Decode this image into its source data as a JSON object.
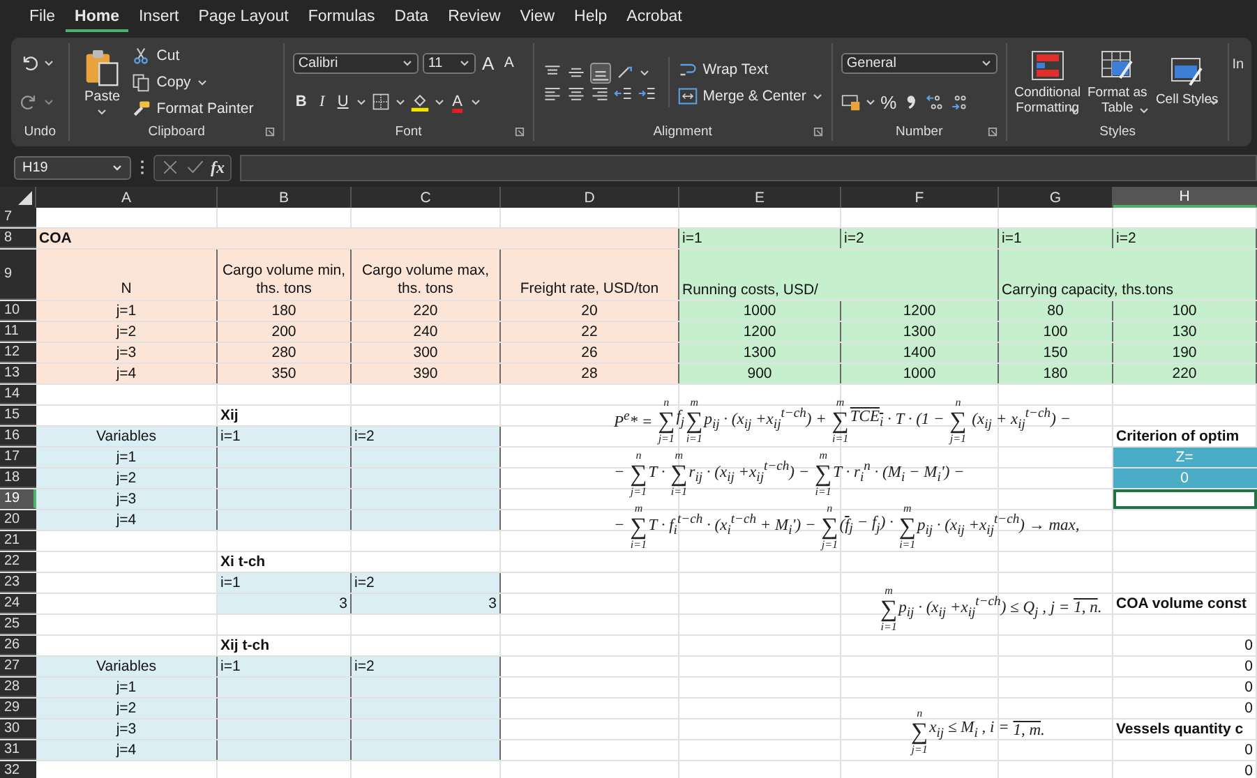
{
  "menu": [
    {
      "label": "File",
      "selected": false
    },
    {
      "label": "Home",
      "selected": true
    },
    {
      "label": "Insert",
      "selected": false
    },
    {
      "label": "Page Layout",
      "selected": false
    },
    {
      "label": "Formulas",
      "selected": false
    },
    {
      "label": "Data",
      "selected": false
    },
    {
      "label": "Review",
      "selected": false
    },
    {
      "label": "View",
      "selected": false
    },
    {
      "label": "Help",
      "selected": false
    },
    {
      "label": "Acrobat",
      "selected": false
    }
  ],
  "ribbon": {
    "undo": {
      "label": "Undo"
    },
    "clipboard": {
      "paste": "Paste",
      "cut": "Cut",
      "copy": "Copy",
      "format_painter": "Format Painter",
      "label": "Clipboard"
    },
    "font": {
      "family": "Calibri",
      "size": "11",
      "grow": "A",
      "shrink": "A",
      "bold": "B",
      "italic": "I",
      "underline": "U",
      "font_color_letter": "A",
      "label": "Font"
    },
    "alignment": {
      "wrap": "Wrap Text",
      "merge": "Merge & Center",
      "label": "Alignment"
    },
    "number": {
      "format": "General",
      "percent": "%",
      "label": "Number"
    },
    "styles": {
      "buttons": [
        "Conditional Formatting",
        "Format as Table",
        "Cell Styles"
      ],
      "label": "Styles"
    },
    "cut_off": "In"
  },
  "formula_bar": {
    "name_box": "H19",
    "fx": "fx"
  },
  "columns": [
    {
      "label": "A",
      "selected": false
    },
    {
      "label": "B",
      "selected": false
    },
    {
      "label": "C",
      "selected": false
    },
    {
      "label": "D",
      "selected": false
    },
    {
      "label": "E",
      "selected": false
    },
    {
      "label": "F",
      "selected": false
    },
    {
      "label": "G",
      "selected": false
    },
    {
      "label": "H",
      "selected": true
    }
  ],
  "rows": [
    {
      "number": "7",
      "selected": false,
      "cells": [
        null,
        null,
        null,
        null,
        null,
        null,
        null,
        null
      ]
    },
    {
      "number": "8",
      "selected": false,
      "cells": [
        {
          "text": "COA",
          "merged": true,
          "color": "#fce4d6",
          "kind": "title"
        },
        null,
        null,
        null,
        {
          "text": "i=1",
          "color": "#c6efce",
          "kind": "tag"
        },
        {
          "text": "i=2",
          "color": "#c6efce",
          "kind": "tag"
        },
        {
          "text": "i=1",
          "color": "#c6efce",
          "kind": "tag"
        },
        {
          "text": "i=2",
          "color": "#c6efce",
          "kind": "tag"
        }
      ]
    },
    {
      "number": "9",
      "selected": false,
      "cells": [
        {
          "text": "N",
          "color": "#fce4d6",
          "kind": "head"
        },
        {
          "text": "Cargo volume min, ths. tons",
          "color": "#fce4d6",
          "kind": "head"
        },
        {
          "text": "Cargo volume max, ths. tons",
          "color": "#fce4d6",
          "kind": "head"
        },
        {
          "text": "Freight rate, USD/ton",
          "color": "#fce4d6",
          "kind": "head"
        },
        {
          "text": "Running costs, USD/",
          "merged": true,
          "color": "#c6efce",
          "kind": "headleft"
        },
        null,
        {
          "text": "Carrying capacity, ths.tons",
          "merged": true,
          "color": "#c6efce",
          "kind": "headleft"
        },
        null
      ]
    },
    {
      "number": "10",
      "selected": false,
      "cells": [
        {
          "text": "j=1",
          "color": "#fce4d6",
          "kind": "value"
        },
        {
          "text": "180",
          "color": "#fce4d6",
          "kind": "value"
        },
        {
          "text": "220",
          "color": "#fce4d6",
          "kind": "value"
        },
        {
          "text": "20",
          "color": "#fce4d6",
          "kind": "value"
        },
        {
          "text": "1000",
          "color": "#c6efce",
          "kind": "value"
        },
        {
          "text": "1200",
          "color": "#c6efce",
          "kind": "value"
        },
        {
          "text": "80",
          "color": "#c6efce",
          "kind": "value"
        },
        {
          "text": "100",
          "color": "#c6efce",
          "kind": "value"
        }
      ]
    },
    {
      "number": "11",
      "selected": false,
      "cells": [
        {
          "text": "j=2",
          "color": "#fce4d6",
          "kind": "value"
        },
        {
          "text": "200",
          "color": "#fce4d6",
          "kind": "value"
        },
        {
          "text": "240",
          "color": "#fce4d6",
          "kind": "value"
        },
        {
          "text": "22",
          "color": "#fce4d6",
          "kind": "value"
        },
        {
          "text": "1200",
          "color": "#c6efce",
          "kind": "value"
        },
        {
          "text": "1300",
          "color": "#c6efce",
          "kind": "value"
        },
        {
          "text": "100",
          "color": "#c6efce",
          "kind": "value"
        },
        {
          "text": "130",
          "color": "#c6efce",
          "kind": "value"
        }
      ]
    },
    {
      "number": "12",
      "selected": false,
      "cells": [
        {
          "text": "j=3",
          "color": "#fce4d6",
          "kind": "value"
        },
        {
          "text": "280",
          "color": "#fce4d6",
          "kind": "value"
        },
        {
          "text": "300",
          "color": "#fce4d6",
          "kind": "value"
        },
        {
          "text": "26",
          "color": "#fce4d6",
          "kind": "value"
        },
        {
          "text": "1300",
          "color": "#c6efce",
          "kind": "value"
        },
        {
          "text": "1400",
          "color": "#c6efce",
          "kind": "value"
        },
        {
          "text": "150",
          "color": "#c6efce",
          "kind": "value"
        },
        {
          "text": "190",
          "color": "#c6efce",
          "kind": "value"
        }
      ]
    },
    {
      "number": "13",
      "selected": false,
      "cells": [
        {
          "text": "j=4",
          "color": "#fce4d6",
          "kind": "value"
        },
        {
          "text": "350",
          "color": "#fce4d6",
          "kind": "value"
        },
        {
          "text": "390",
          "color": "#fce4d6",
          "kind": "value"
        },
        {
          "text": "28",
          "color": "#fce4d6",
          "kind": "value"
        },
        {
          "text": "900",
          "color": "#c6efce",
          "kind": "value"
        },
        {
          "text": "1000",
          "color": "#c6efce",
          "kind": "value"
        },
        {
          "text": "180",
          "color": "#c6efce",
          "kind": "value"
        },
        {
          "text": "220",
          "color": "#c6efce",
          "kind": "value"
        }
      ]
    },
    {
      "number": "14",
      "selected": false,
      "cells": [
        null,
        null,
        null,
        null,
        null,
        null,
        null,
        null
      ]
    },
    {
      "number": "15",
      "selected": false,
      "cells": [
        null,
        {
          "text": "Xij",
          "kind": "title"
        },
        null,
        null,
        null,
        null,
        null,
        null
      ]
    },
    {
      "number": "16",
      "selected": false,
      "cells": [
        {
          "text": "Variables",
          "color": "#daeef3",
          "kind": "value"
        },
        {
          "text": "i=1",
          "color": "#daeef3",
          "kind": "tag"
        },
        {
          "text": "i=2",
          "color": "#daeef3",
          "kind": "tag"
        },
        null,
        null,
        null,
        null,
        {
          "text": "Criterion of optim",
          "kind": "title"
        }
      ]
    },
    {
      "number": "17",
      "selected": false,
      "cells": [
        {
          "text": "j=1",
          "color": "#daeef3",
          "kind": "value"
        },
        {
          "color": "#daeef3",
          "kind": "value"
        },
        {
          "color": "#daeef3",
          "kind": "value"
        },
        null,
        null,
        null,
        null,
        {
          "text": "Z=",
          "color": "#4bacc6",
          "kind": "result"
        }
      ]
    },
    {
      "number": "18",
      "selected": false,
      "cells": [
        {
          "text": "j=2",
          "color": "#daeef3",
          "kind": "value"
        },
        {
          "color": "#daeef3",
          "kind": "value"
        },
        {
          "color": "#daeef3",
          "kind": "value"
        },
        null,
        null,
        null,
        null,
        {
          "text": "0",
          "color": "#4bacc6",
          "kind": "result"
        }
      ]
    },
    {
      "number": "19",
      "selected": true,
      "cells": [
        {
          "text": "j=3",
          "color": "#daeef3",
          "kind": "value"
        },
        {
          "color": "#daeef3",
          "kind": "value"
        },
        {
          "color": "#daeef3",
          "kind": "value"
        },
        null,
        null,
        null,
        null,
        null
      ]
    },
    {
      "number": "20",
      "selected": false,
      "cells": [
        {
          "text": "j=4",
          "color": "#daeef3",
          "kind": "value"
        },
        {
          "color": "#daeef3",
          "kind": "value"
        },
        {
          "color": "#daeef3",
          "kind": "value"
        },
        null,
        null,
        null,
        null,
        null
      ]
    },
    {
      "number": "21",
      "selected": false,
      "cells": [
        null,
        null,
        null,
        null,
        null,
        null,
        null,
        null
      ]
    },
    {
      "number": "22",
      "selected": false,
      "cells": [
        null,
        {
          "text": "Xi t-ch",
          "kind": "title"
        },
        null,
        null,
        null,
        null,
        null,
        null
      ]
    },
    {
      "number": "23",
      "selected": false,
      "cells": [
        null,
        {
          "text": "i=1",
          "color": "#daeef3",
          "kind": "tag"
        },
        {
          "text": "i=2",
          "color": "#daeef3",
          "kind": "tag"
        },
        null,
        null,
        null,
        null,
        null
      ]
    },
    {
      "number": "24",
      "selected": false,
      "cells": [
        null,
        {
          "text": "3",
          "color": "#daeef3",
          "kind": "number"
        },
        {
          "text": "3",
          "color": "#daeef3",
          "kind": "number"
        },
        null,
        null,
        null,
        null,
        {
          "text": "COA volume const",
          "kind": "title"
        }
      ]
    },
    {
      "number": "25",
      "selected": false,
      "cells": [
        null,
        null,
        null,
        null,
        null,
        null,
        null,
        null
      ]
    },
    {
      "number": "26",
      "selected": false,
      "cells": [
        null,
        {
          "text": "Xij t-ch",
          "kind": "title"
        },
        null,
        null,
        null,
        null,
        null,
        {
          "text": "0",
          "kind": "number"
        }
      ]
    },
    {
      "number": "27",
      "selected": false,
      "cells": [
        {
          "text": "Variables",
          "color": "#daeef3",
          "kind": "value"
        },
        {
          "text": "i=1",
          "color": "#daeef3",
          "kind": "tag"
        },
        {
          "text": "i=2",
          "color": "#daeef3",
          "kind": "tag"
        },
        null,
        null,
        null,
        null,
        {
          "text": "0",
          "kind": "number"
        }
      ]
    },
    {
      "number": "28",
      "selected": false,
      "cells": [
        {
          "text": "j=1",
          "color": "#daeef3",
          "kind": "value"
        },
        {
          "color": "#daeef3",
          "kind": "value"
        },
        {
          "color": "#daeef3",
          "kind": "value"
        },
        null,
        null,
        null,
        null,
        {
          "text": "0",
          "kind": "number"
        }
      ]
    },
    {
      "number": "29",
      "selected": false,
      "cells": [
        {
          "text": "j=2",
          "color": "#daeef3",
          "kind": "value"
        },
        {
          "color": "#daeef3",
          "kind": "value"
        },
        {
          "color": "#daeef3",
          "kind": "value"
        },
        null,
        null,
        null,
        null,
        {
          "text": "0",
          "kind": "number"
        }
      ]
    },
    {
      "number": "30",
      "selected": false,
      "cells": [
        {
          "text": "j=3",
          "color": "#daeef3",
          "kind": "value"
        },
        {
          "color": "#daeef3",
          "kind": "value"
        },
        {
          "color": "#daeef3",
          "kind": "value"
        },
        null,
        null,
        null,
        null,
        {
          "text": "Vessels quantity c",
          "kind": "title"
        }
      ]
    },
    {
      "number": "31",
      "selected": false,
      "cells": [
        {
          "text": "j=4",
          "color": "#daeef3",
          "kind": "value"
        },
        {
          "color": "#daeef3",
          "kind": "value"
        },
        {
          "color": "#daeef3",
          "kind": "value"
        },
        null,
        null,
        null,
        null,
        {
          "text": "0",
          "kind": "number"
        }
      ]
    },
    {
      "number": "32",
      "selected": false,
      "cells": [
        null,
        null,
        null,
        null,
        null,
        null,
        null,
        {
          "text": "0",
          "kind": "number"
        }
      ]
    }
  ],
  "formulas": [
    {
      "lines": [
        [
          {
            "kind": "text",
            "text": "P$^{e}$* = "
          },
          {
            "kind": "sum",
            "symbol": "∑",
            "upper": "n",
            "lower": "j=1"
          },
          {
            "kind": "text",
            "text": "f$_{j}$"
          },
          {
            "kind": "sum",
            "symbol": "∑",
            "upper": "m",
            "lower": "i=1"
          },
          {
            "kind": "text",
            "text": "p$_{ij}$ · (x$_{ij}$ +x$_{ij}$$^{t−ch}$) + "
          },
          {
            "kind": "sum",
            "symbol": "∑",
            "upper": "m",
            "lower": "i=1"
          },
          {
            "kind": "over",
            "text": "TCE$_{i}$"
          },
          {
            "kind": "text",
            "text": " · T · (1 − "
          },
          {
            "kind": "sum",
            "symbol": "∑",
            "upper": "n",
            "lower": "j=1"
          },
          {
            "kind": "text",
            "text": " (x$_{ij}$ + x$_{ij}$$^{t−ch}$) −"
          }
        ],
        [
          {
            "kind": "text",
            "text": "− "
          },
          {
            "kind": "sum",
            "symbol": "∑",
            "upper": "n",
            "lower": "j=1"
          },
          {
            "kind": "text",
            "text": "T · "
          },
          {
            "kind": "sum",
            "symbol": "∑",
            "upper": "m",
            "lower": "i=1"
          },
          {
            "kind": "text",
            "text": "r$_{ij}$ · (x$_{ij}$ +x$_{ij}$$^{t−ch}$) − "
          },
          {
            "kind": "sum",
            "symbol": "∑",
            "upper": "m",
            "lower": "i=1"
          },
          {
            "kind": "text",
            "text": "T · r$_{i}$$^{n}$ · (M$_{i}$ − M$_{i}$ʹ) −"
          }
        ],
        [
          {
            "kind": "text",
            "text": "− "
          },
          {
            "kind": "sum",
            "symbol": "∑",
            "upper": "m",
            "lower": "i=1"
          },
          {
            "kind": "text",
            "text": "T · f$_{i}$$^{t−ch}$ · (x$_{i}$$^{t−ch}$ + M$_{i}$ʹ) − "
          },
          {
            "kind": "sum",
            "symbol": "∑",
            "upper": "n",
            "lower": "j=1"
          },
          {
            "kind": "text",
            "text": "("
          },
          {
            "kind": "over",
            "text": "f"
          },
          {
            "kind": "text",
            "text": "$_{j}$ − f$_{j}$) · "
          },
          {
            "kind": "sum",
            "symbol": "∑",
            "upper": "m",
            "lower": "i=1"
          },
          {
            "kind": "text",
            "text": "p$_{ij}$ · (x$_{ij}$ +x$_{ij}$$^{t−ch}$) → max,"
          }
        ]
      ]
    },
    {
      "lines": [
        [
          {
            "kind": "sum",
            "symbol": "∑",
            "upper": "m",
            "lower": "i=1"
          },
          {
            "kind": "text",
            "text": "p$_{ij}$ · (x$_{ij}$ +x$_{ij}$$^{t−ch}$) ≤ Q$_{j}$ , j = "
          },
          {
            "kind": "over",
            "text": "1, n"
          },
          {
            "kind": "text",
            "text": "."
          }
        ]
      ]
    },
    {
      "lines": [
        [
          {
            "kind": "sum",
            "symbol": "∑",
            "upper": "n",
            "lower": "j=1"
          },
          {
            "kind": "text",
            "text": "x$_{ij}$ ≤ M$_{i}$ , i = "
          },
          {
            "kind": "over",
            "text": "1, m"
          },
          {
            "kind": "text",
            "text": "."
          }
        ]
      ]
    }
  ]
}
